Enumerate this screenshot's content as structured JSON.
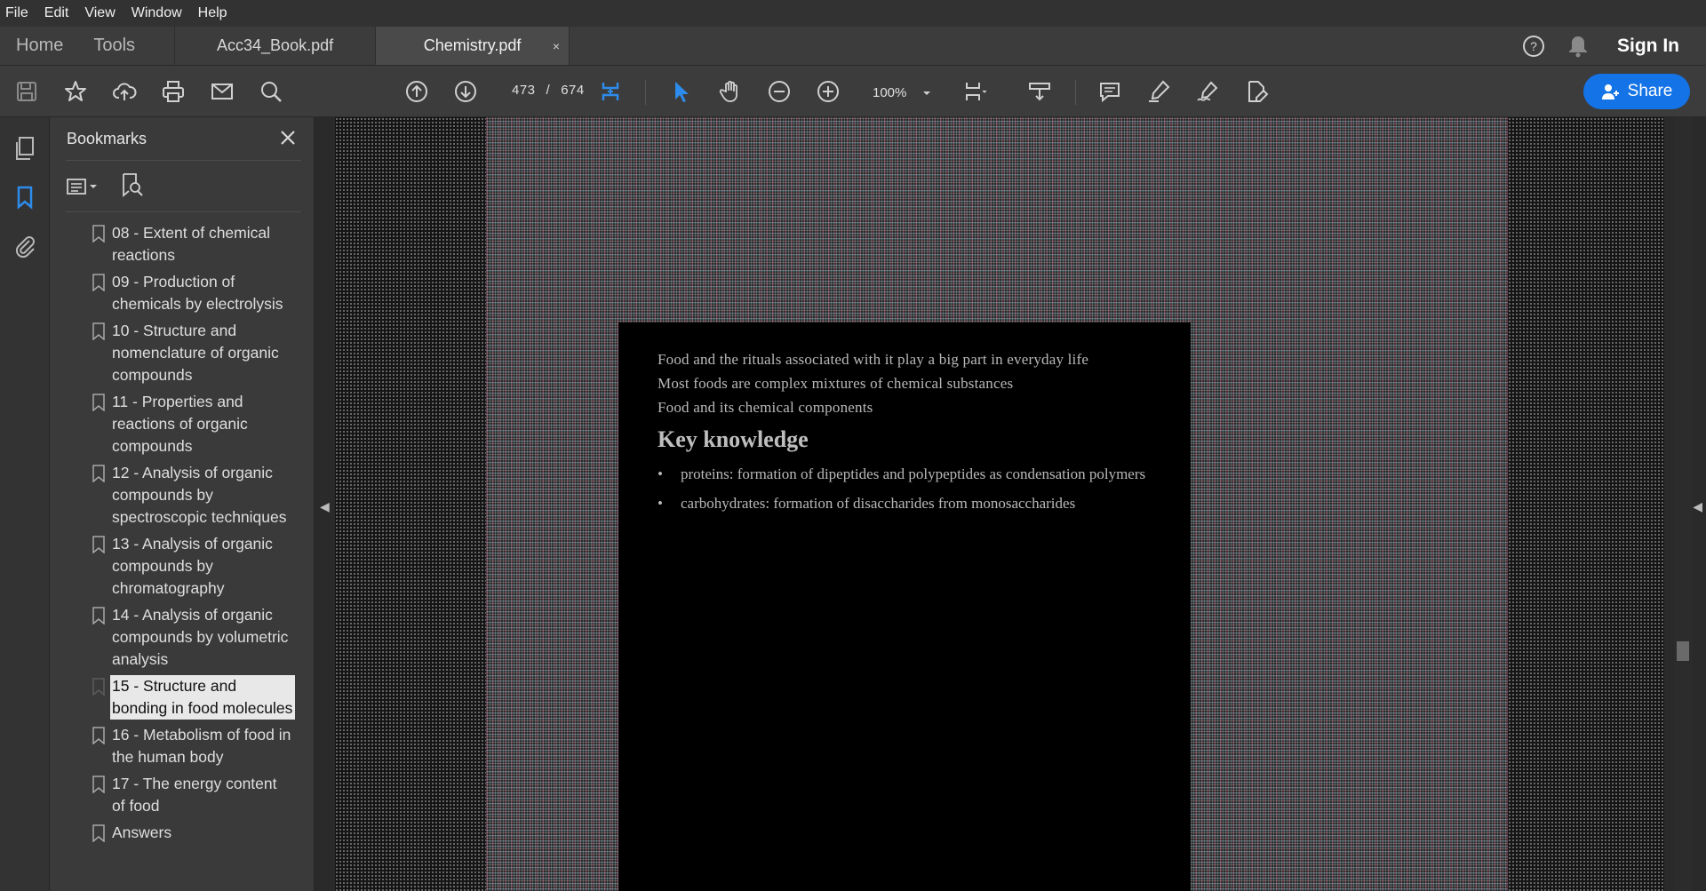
{
  "menu": [
    "File",
    "Edit",
    "View",
    "Window",
    "Help"
  ],
  "nav": {
    "home": "Home",
    "tools": "Tools"
  },
  "tabs": [
    {
      "label": "Acc34_Book.pdf",
      "active": false
    },
    {
      "label": "Chemistry.pdf",
      "active": true,
      "close": "×"
    }
  ],
  "header": {
    "sign_in": "Sign In",
    "help_icon": "help-icon",
    "bell_icon": "bell-icon"
  },
  "toolbar": {
    "current_page": "473",
    "page_sep": "/",
    "total_pages": "674",
    "zoom": "100%",
    "share_label": "Share",
    "accent": "#1473e6"
  },
  "bookmarks": {
    "title": "Bookmarks",
    "items": [
      {
        "label": "08 - Extent of chemical reactions"
      },
      {
        "label": "09 - Production of chemicals by electrolysis"
      },
      {
        "label": "10 - Structure and nomenclature of organic compounds"
      },
      {
        "label": "11 - Properties and reactions of organic compounds"
      },
      {
        "label": "12 - Analysis of organic compounds by spectroscopic techniques"
      },
      {
        "label": "13 - Analysis of organic compounds by chromatography"
      },
      {
        "label": "14 - Analysis of organic compounds by volumetric analysis"
      },
      {
        "label": "15 - Structure and bonding in food molecules",
        "selected": true
      },
      {
        "label": "16 - Metabolism of food in the human body"
      },
      {
        "label": "17 - The energy content of food"
      },
      {
        "label": "Answers"
      }
    ]
  },
  "document": {
    "paragraphs": [
      "Food and the rituals associated with it play a big part in everyday life",
      "Most foods are complex mixtures of chemical substances",
      "Food and its chemical components"
    ],
    "heading": "Key knowledge",
    "bullets": [
      "proteins: formation of dipeptides and polypeptides as condensation polymers",
      "carbohydrates: formation of disaccharides from monosaccharides"
    ]
  }
}
